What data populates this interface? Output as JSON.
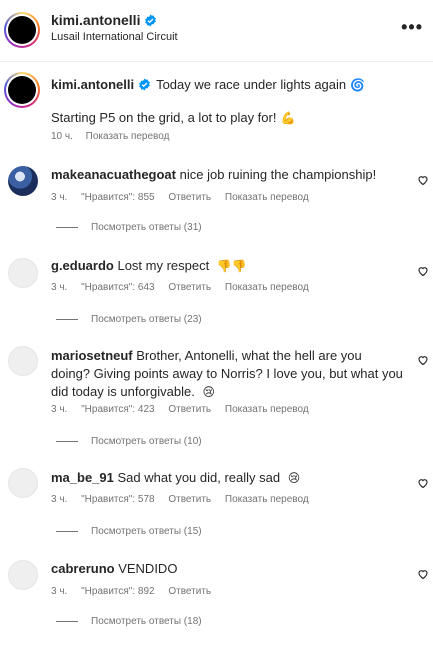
{
  "header": {
    "username": "kimi.antonelli",
    "location": "Lusail International Circuit",
    "more_icon": "more-horizontal-icon"
  },
  "caption": {
    "username": "kimi.antonelli",
    "text_line1": "Today we race under lights again",
    "emoji1": "🌀",
    "text_line2": "Starting P5 on the grid, a lot to play for!",
    "emoji2": "💪",
    "time": "10 ч.",
    "translate": "Показать перевод"
  },
  "comments": [
    {
      "username": "makeanacuathegoat",
      "text": "nice job ruining the championship!",
      "time": "3 ч.",
      "likes": "\"Нравится\": 855",
      "reply": "Ответить",
      "translate": "Показать перевод",
      "view_replies": "Посмотреть ответы (31)"
    },
    {
      "username": "g.eduardo",
      "text": "Lost my respect",
      "emoji": "👎👎",
      "time": "3 ч.",
      "likes": "\"Нравится\": 643",
      "reply": "Ответить",
      "translate": "Показать перевод",
      "view_replies": "Посмотреть ответы (23)"
    },
    {
      "username": "mariosetneuf",
      "text": "Brother, Antonelli, what the hell are you doing? Giving points away to Norris? I love you, but what you did today is unforgivable.",
      "emoji": "😢",
      "time": "3 ч.",
      "likes": "\"Нравится\": 423",
      "reply": "Ответить",
      "translate": "Показать перевод",
      "view_replies": "Посмотреть ответы (10)"
    },
    {
      "username": "ma_be_91",
      "text": "Sad what you did, really sad",
      "emoji": "😢",
      "time": "3 ч.",
      "likes": "\"Нравится\": 578",
      "reply": "Ответить",
      "translate": "Показать перевод",
      "view_replies": "Посмотреть ответы (15)"
    },
    {
      "username": "cabreruno",
      "text": "VENDIDO",
      "time": "3 ч.",
      "likes": "\"Нравится\": 892",
      "reply": "Ответить",
      "view_replies": "Посмотреть ответы (18)"
    }
  ],
  "colors": {
    "verified": "#0095f6",
    "meta": "#737373",
    "text": "#262626"
  }
}
